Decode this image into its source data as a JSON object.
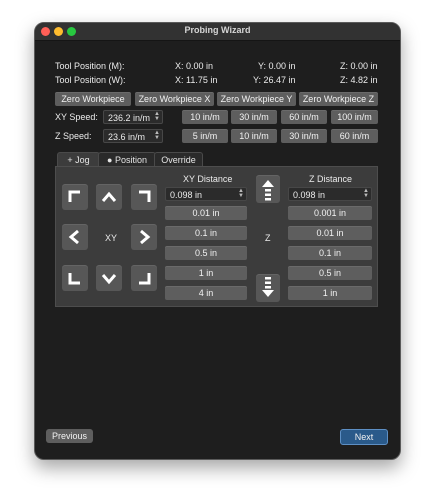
{
  "window": {
    "title": "Probing Wizard"
  },
  "position": {
    "machine_label": "Tool Position (M):",
    "machine": {
      "x": "X: 0.00 in",
      "y": "Y: 0.00 in",
      "z": "Z: 0.00 in"
    },
    "work_label": "Tool Position (W):",
    "work": {
      "x": "X: 11.75 in",
      "y": "Y: 26.47 in",
      "z": "Z: 4.82 in"
    }
  },
  "zero_buttons": [
    "Zero Workpiece",
    "Zero Workpiece X",
    "Zero Workpiece Y",
    "Zero Workpiece Z"
  ],
  "xy_speed": {
    "label": "XY Speed:",
    "value": "236.2 in/m",
    "presets": [
      "10 in/m",
      "30 in/m",
      "60 in/m",
      "100 in/m"
    ]
  },
  "z_speed": {
    "label": "Z Speed:",
    "value": "23.6 in/m",
    "presets": [
      "5 in/m",
      "10 in/m",
      "30 in/m",
      "60 in/m"
    ]
  },
  "tabs": {
    "jog": "Jog",
    "position": "Position",
    "override": "Override"
  },
  "jog": {
    "xy_center_label": "XY",
    "z_center_label": "Z",
    "xy_distance": {
      "header": "XY Distance",
      "value": "0.098 in",
      "presets": [
        "0.01 in",
        "0.1 in",
        "0.5 in",
        "1 in",
        "4 in"
      ]
    },
    "z_distance": {
      "header": "Z Distance",
      "value": "0.098 in",
      "presets": [
        "0.001 in",
        "0.01 in",
        "0.1 in",
        "0.5 in",
        "1 in"
      ]
    }
  },
  "footer": {
    "previous": "Previous",
    "next": "Next"
  },
  "colors": {
    "next_button": "#2a5a8a",
    "background": "#1e1e1e",
    "button": "#5e5e5e"
  }
}
